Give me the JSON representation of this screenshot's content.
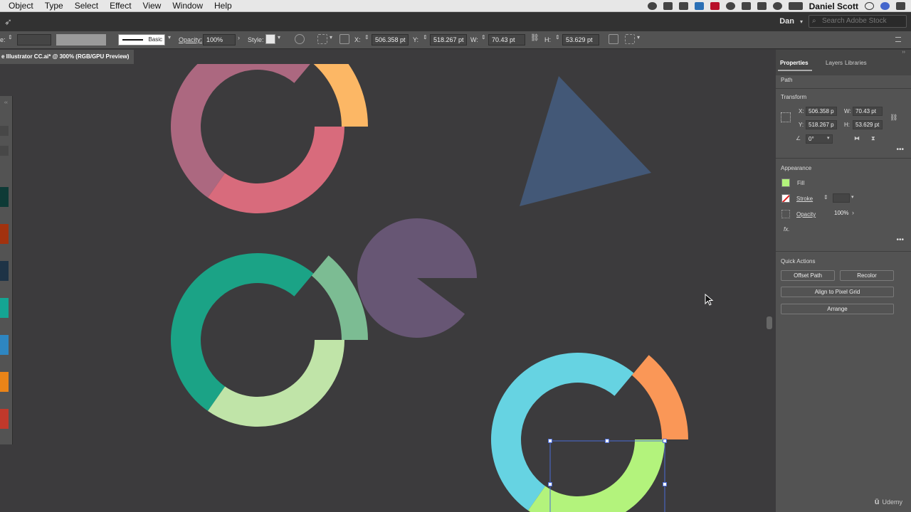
{
  "menubar": {
    "items": [
      "Object",
      "Type",
      "Select",
      "Effect",
      "View",
      "Window",
      "Help"
    ],
    "user": "Daniel Scott"
  },
  "appbar": {
    "workspace": "Dan",
    "stock_placeholder": "Search Adobe Stock"
  },
  "controlbar": {
    "prefix": "e:",
    "stroke_style": "Basic",
    "opacity_label": "Opacity:",
    "opacity_value": "100%",
    "style_label": "Style:",
    "x_label": "X:",
    "x_value": "506.358 pt",
    "y_label": "Y:",
    "y_value": "518.267 pt",
    "w_label": "W:",
    "w_value": "70.43 pt",
    "h_label": "H:",
    "h_value": "53.629 pt"
  },
  "document_tab": "e Illustrator CC.ai* @ 300% (RGB/GPU Preview)",
  "left_panel_swatches": [
    "#0e3a36",
    "#a2320e",
    "#1e3346",
    "#14a593",
    "#2e86c1",
    "#ea8418",
    "#c0392b"
  ],
  "artwork_colors": {
    "mauve": "#ac6880",
    "pink": "#d86b7c",
    "orange_light": "#fcb765",
    "slate_blue": "#435877",
    "teal": "#1ba386",
    "mint": "#7cbc93",
    "purple": "#675674",
    "pale_green": "#c0e4a8",
    "cyan": "#66d3e2",
    "coral": "#fa9757",
    "lime": "#b3f37c",
    "selection": "#4a6bd6"
  },
  "properties": {
    "tabs": [
      "Properties",
      "Layers",
      "Libraries"
    ],
    "object_type": "Path",
    "transform_title": "Transform",
    "x_label": "X:",
    "x_value": "506.358 p",
    "y_label": "Y:",
    "y_value": "518.267 p",
    "w_label": "W:",
    "w_value": "70.43 pt",
    "h_label": "H:",
    "h_value": "53.629 pt",
    "rotation_value": "0°",
    "appearance_title": "Appearance",
    "fill_label": "Fill",
    "fill_color": "#b3f37c",
    "stroke_label": "Stroke",
    "opacity_label": "Opacity",
    "opacity_value": "100%",
    "fx_label": "fx.",
    "quick_actions_title": "Quick Actions",
    "offset_path": "Offset Path",
    "recolor": "Recolor",
    "align_pixel_grid": "Align to Pixel Grid",
    "arrange": "Arrange"
  },
  "watermark": "Udemy"
}
